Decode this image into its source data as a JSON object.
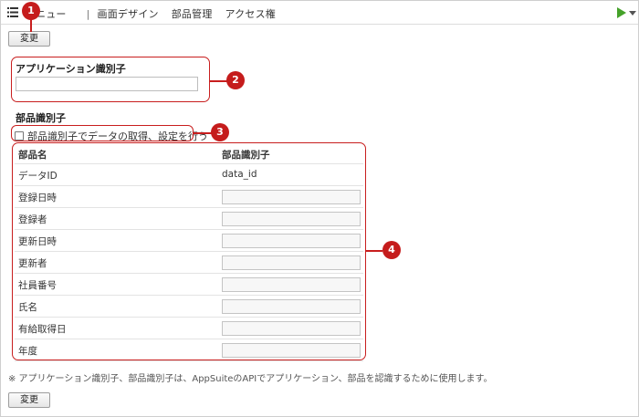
{
  "topbar": {
    "menu_items": [
      "ニュー",
      "画面デザイン",
      "部品管理",
      "アクセス権"
    ],
    "separator": "|",
    "icons": {
      "menu": "list-icon",
      "run": "play-icon",
      "more": "caret-down-icon"
    },
    "run_color": "#45a22a"
  },
  "buttons": {
    "change_top": "変更",
    "change_bottom": "変更"
  },
  "app_section": {
    "label": "アプリケーション識別子",
    "value": "",
    "placeholder": ""
  },
  "parts_section": {
    "label": "部品識別子",
    "checkbox_label": "部品識別子でデータの取得、設定を行う",
    "checked": false
  },
  "table": {
    "headers": [
      "部品名",
      "部品識別子"
    ],
    "rows": [
      {
        "name": "データID",
        "id": "data_id",
        "editable": false
      },
      {
        "name": "登録日時",
        "id": "",
        "editable": true
      },
      {
        "name": "登録者",
        "id": "",
        "editable": true
      },
      {
        "name": "更新日時",
        "id": "",
        "editable": true
      },
      {
        "name": "更新者",
        "id": "",
        "editable": true
      },
      {
        "name": "社員番号",
        "id": "",
        "editable": true
      },
      {
        "name": "氏名",
        "id": "",
        "editable": true
      },
      {
        "name": "有給取得日",
        "id": "",
        "editable": true
      },
      {
        "name": "年度",
        "id": "",
        "editable": true
      }
    ]
  },
  "footnote": "※ アプリケーション識別子、部品識別子は、AppSuiteのAPIでアプリケーション、部品を認識するために使用します。",
  "callouts": {
    "b1": "1",
    "b2": "2",
    "b3": "3",
    "b4": "4",
    "color": "#c51c1c"
  }
}
